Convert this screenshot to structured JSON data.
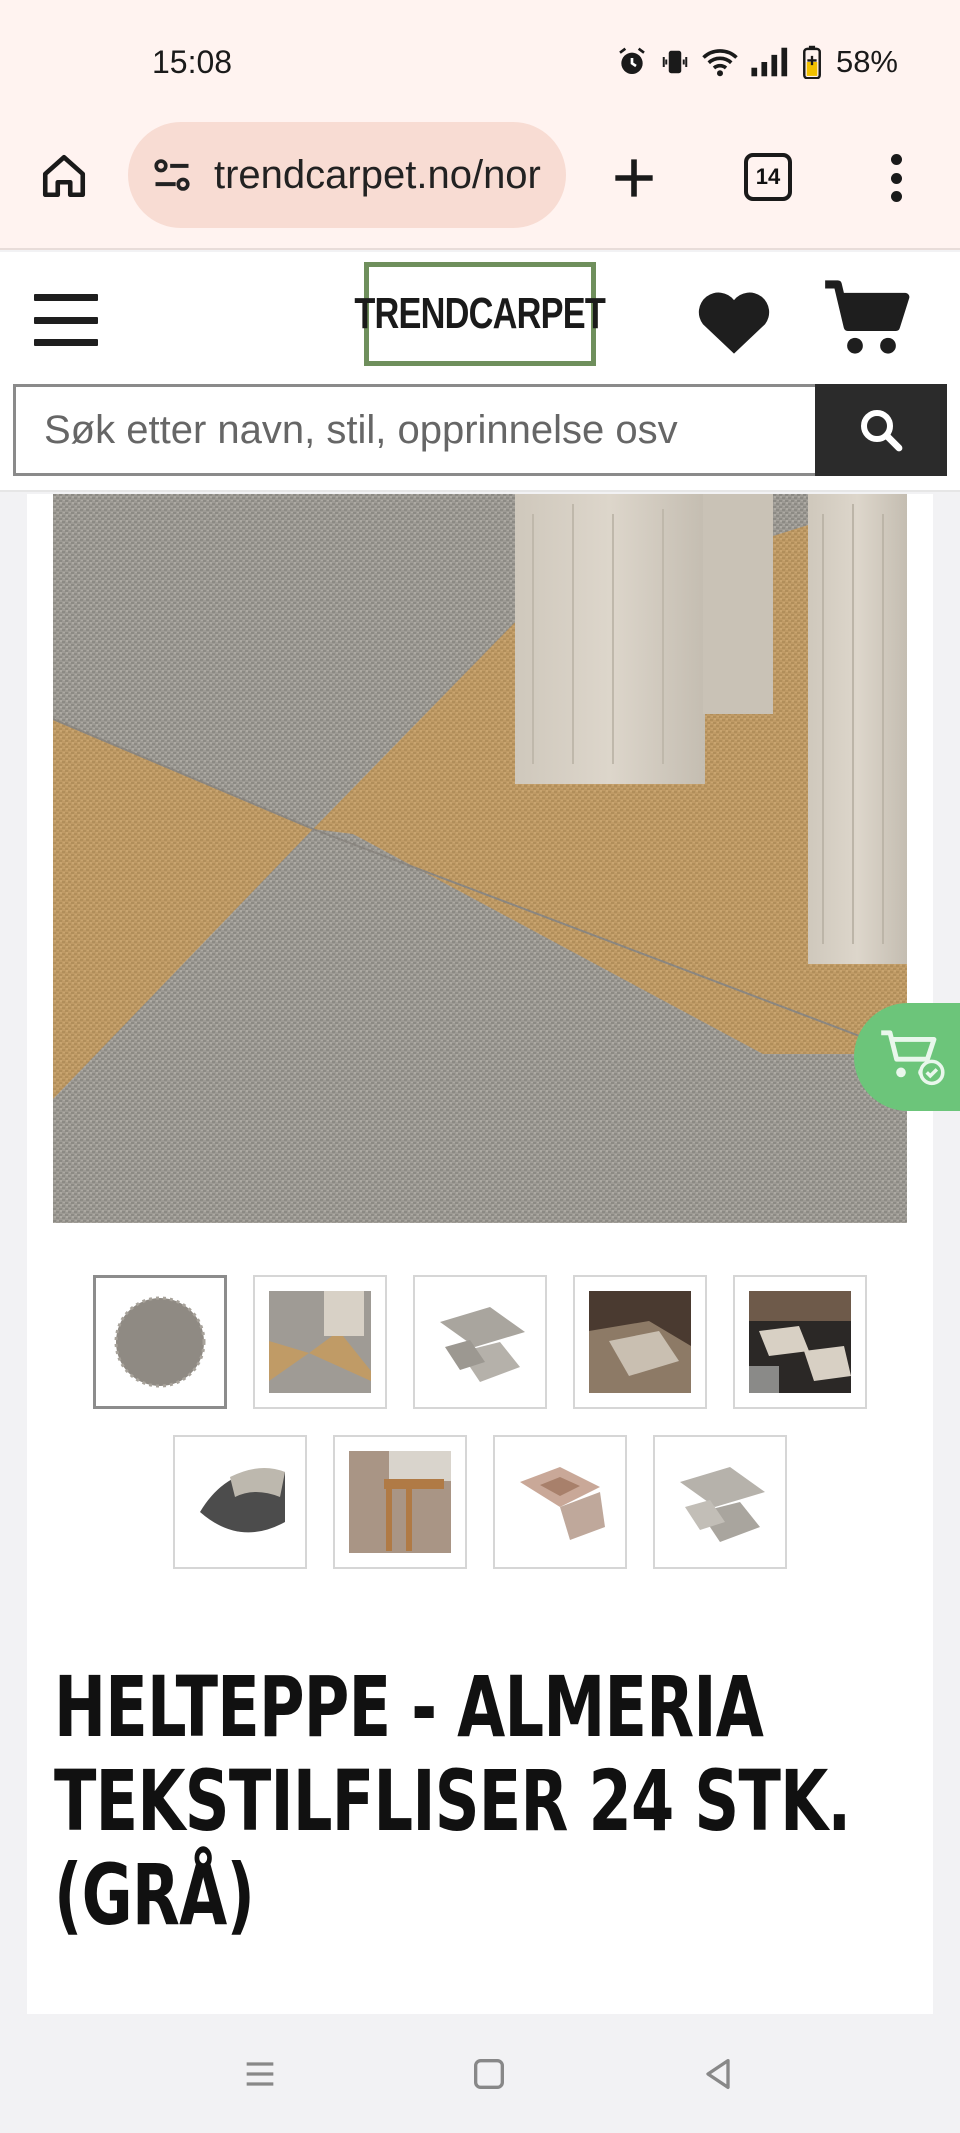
{
  "status_bar": {
    "time": "15:08",
    "battery": "58%"
  },
  "browser": {
    "url": "trendcarpet.no/nor",
    "tab_count": "14"
  },
  "site": {
    "logo": "TRENDCARPET",
    "search_placeholder": "Søk etter navn, stil, opprinnelse osv"
  },
  "product": {
    "title": "HELTEPPE - ALMERIA TEKSTILFLISER 24 STK. (GRÅ)",
    "thumbnail_count": 9,
    "active_thumbnail": 1
  },
  "colors": {
    "header_bg": "#fff3f0",
    "url_pill": "#f8dcd3",
    "logo_border": "#6f8f5c",
    "search_button": "#2b2b2b",
    "cart_float": "#6cc57a"
  },
  "icons": [
    "home-icon",
    "tune-icon",
    "plus-icon",
    "tabs-icon",
    "more-icon",
    "hamburger-icon",
    "heart-icon",
    "cart-icon",
    "search-icon",
    "cart-check-icon",
    "recents-icon",
    "home-nav-icon",
    "back-icon"
  ]
}
